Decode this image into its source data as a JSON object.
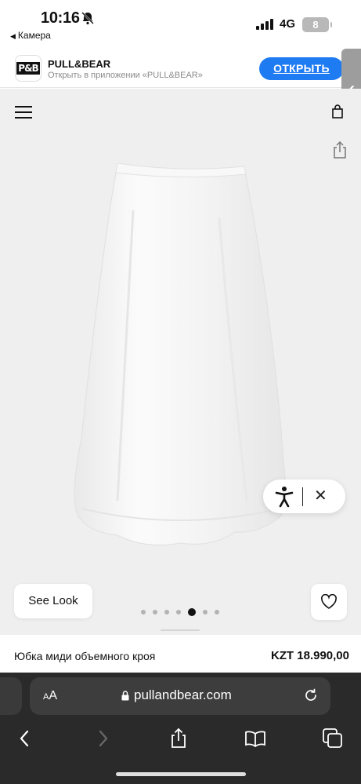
{
  "status_bar": {
    "time": "10:16",
    "back_app": "Камера",
    "network": "4G",
    "battery": "8"
  },
  "app_banner": {
    "logo_text": "P&B",
    "name": "PULL&BEAR",
    "subtitle": "Открыть в приложении «PULL&BEAR»",
    "open_label": "ОТКРЫТЬ"
  },
  "product": {
    "see_look_label": "See Look",
    "name": "Юбка миди объемного кроя",
    "price": "KZT 18.990,00",
    "gallery_count": 7,
    "gallery_active_index": 4
  },
  "browser": {
    "text_size_label": "AA",
    "domain": "pullandbear.com"
  },
  "colors": {
    "open_button": "#1f7bf2",
    "toolbar": "#2a2a2a",
    "image_bg": "#efefef"
  }
}
